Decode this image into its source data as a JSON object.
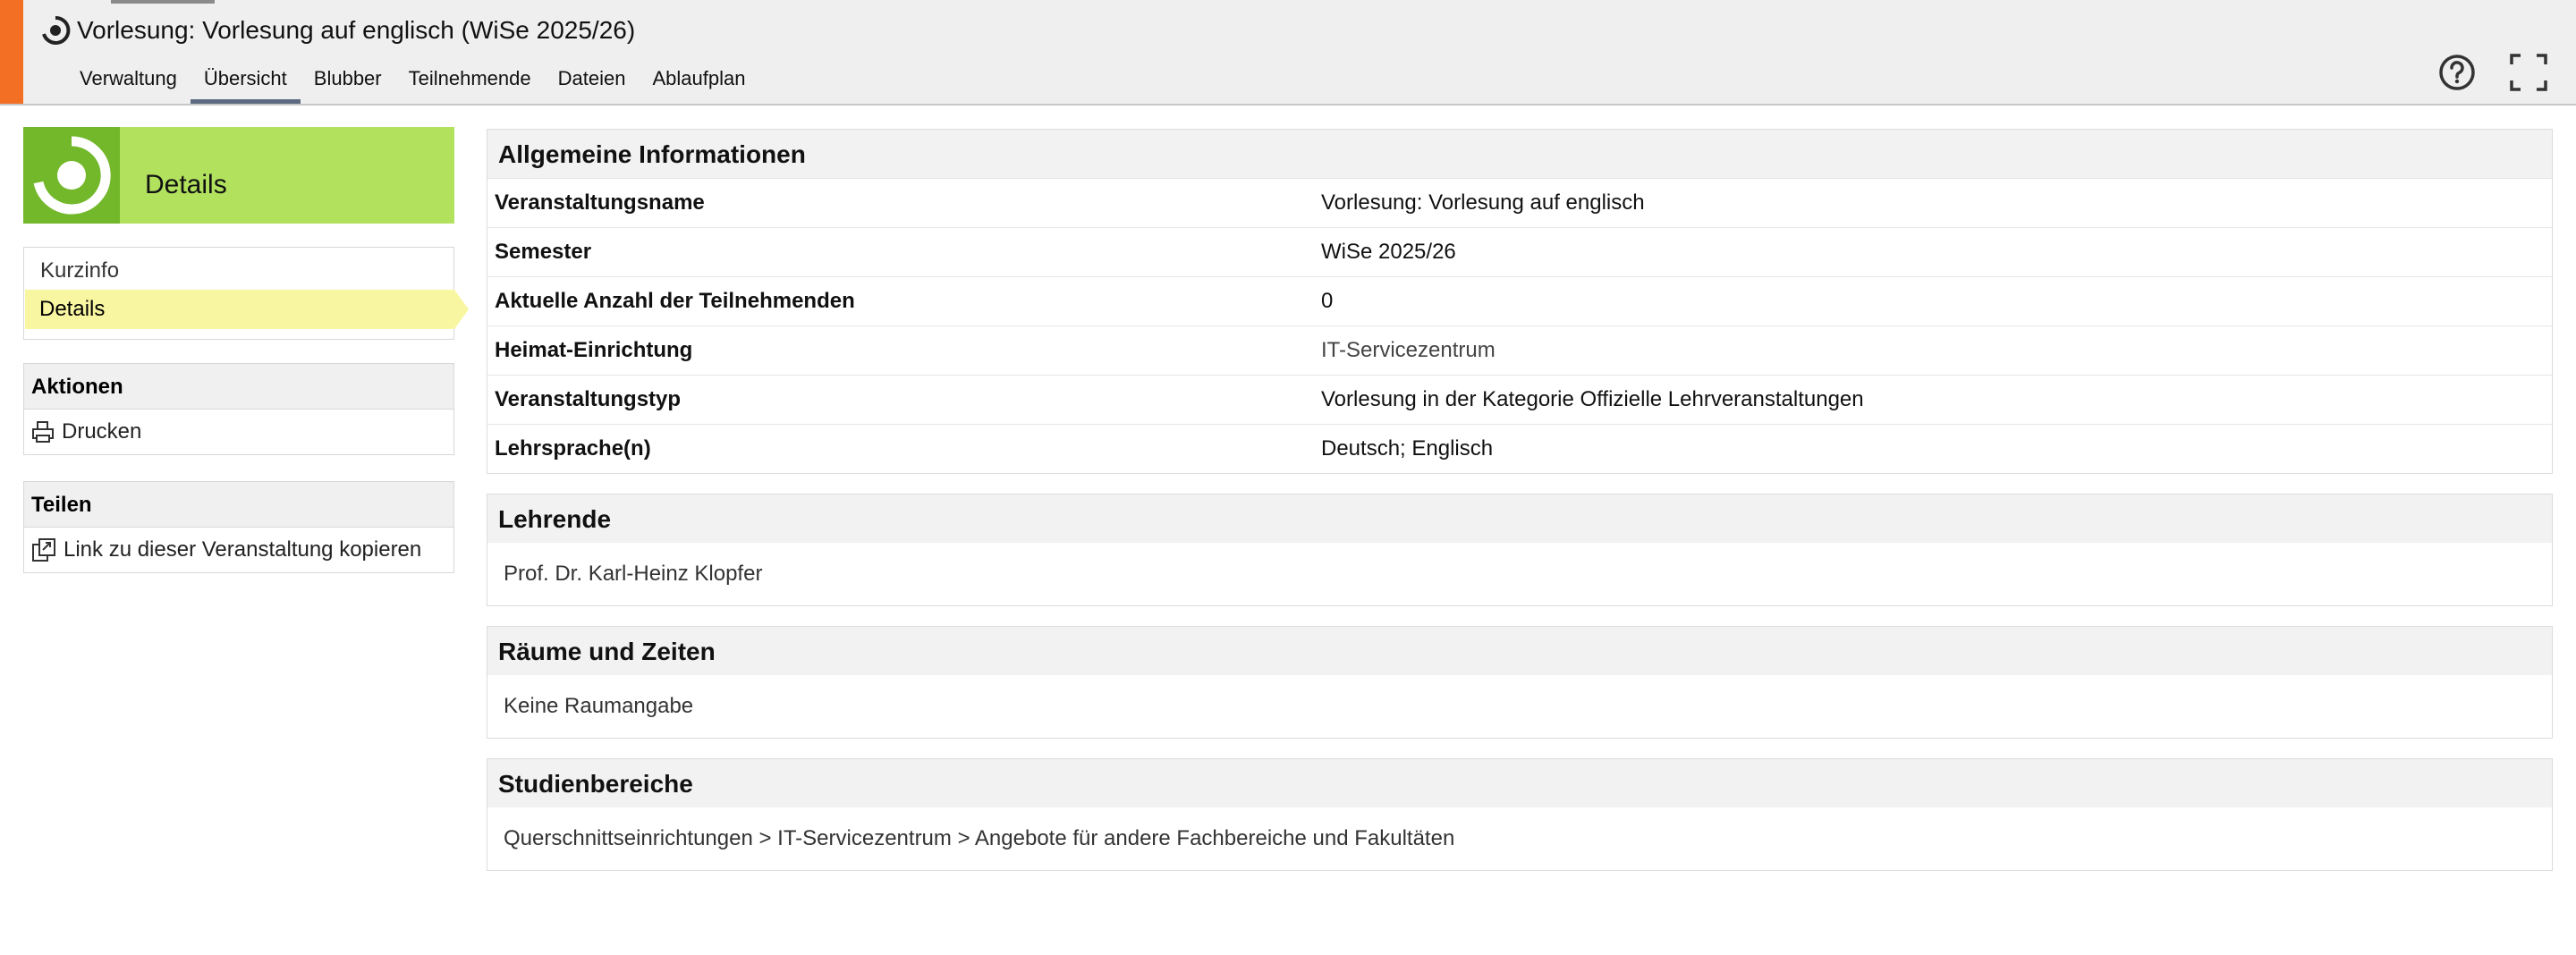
{
  "header": {
    "title": "Vorlesung: Vorlesung auf englisch (WiSe 2025/26)",
    "nav": [
      "Verwaltung",
      "Übersicht",
      "Blubber",
      "Teilnehmende",
      "Dateien",
      "Ablaufplan"
    ],
    "active_nav": "Übersicht",
    "accent_color": "#f26f24",
    "icons": [
      "course-icon",
      "help-icon",
      "fullscreen-icon"
    ]
  },
  "sidebar": {
    "header_title": "Details",
    "header_colors": {
      "light": "#b2e15e",
      "dark": "#72b82a"
    },
    "menu": [
      {
        "label": "Kurzinfo",
        "active": false
      },
      {
        "label": "Details",
        "active": true
      }
    ],
    "aktionen": {
      "title": "Aktionen",
      "items": [
        {
          "icon": "print-icon",
          "label": "Drucken"
        }
      ]
    },
    "teilen": {
      "title": "Teilen",
      "items": [
        {
          "icon": "copy-link-icon",
          "label": "Link zu dieser Veranstaltung kopieren"
        }
      ]
    }
  },
  "main": {
    "info": {
      "title": "Allgemeine Informationen",
      "rows": [
        {
          "key": "Veranstaltungsname",
          "value": "Vorlesung: Vorlesung auf englisch"
        },
        {
          "key": "Semester",
          "value": "WiSe 2025/26"
        },
        {
          "key": "Aktuelle Anzahl der Teilnehmenden",
          "value": "0"
        },
        {
          "key": "Heimat-Einrichtung",
          "value": "IT-Servicezentrum"
        },
        {
          "key": "Veranstaltungstyp",
          "value": "Vorlesung in der Kategorie Offizielle Lehrveranstaltungen"
        },
        {
          "key": "Lehrsprache(n)",
          "value": "Deutsch; Englisch"
        }
      ]
    },
    "lehrende": {
      "title": "Lehrende",
      "content": "Prof. Dr. Karl-Heinz Klopfer"
    },
    "raeume": {
      "title": "Räume und Zeiten",
      "content": "Keine Raumangabe"
    },
    "studienbereiche": {
      "title": "Studienbereiche",
      "content": "Querschnittseinrichtungen > IT-Servicezentrum > Angebote für andere Fachbereiche und Fakultäten"
    }
  }
}
